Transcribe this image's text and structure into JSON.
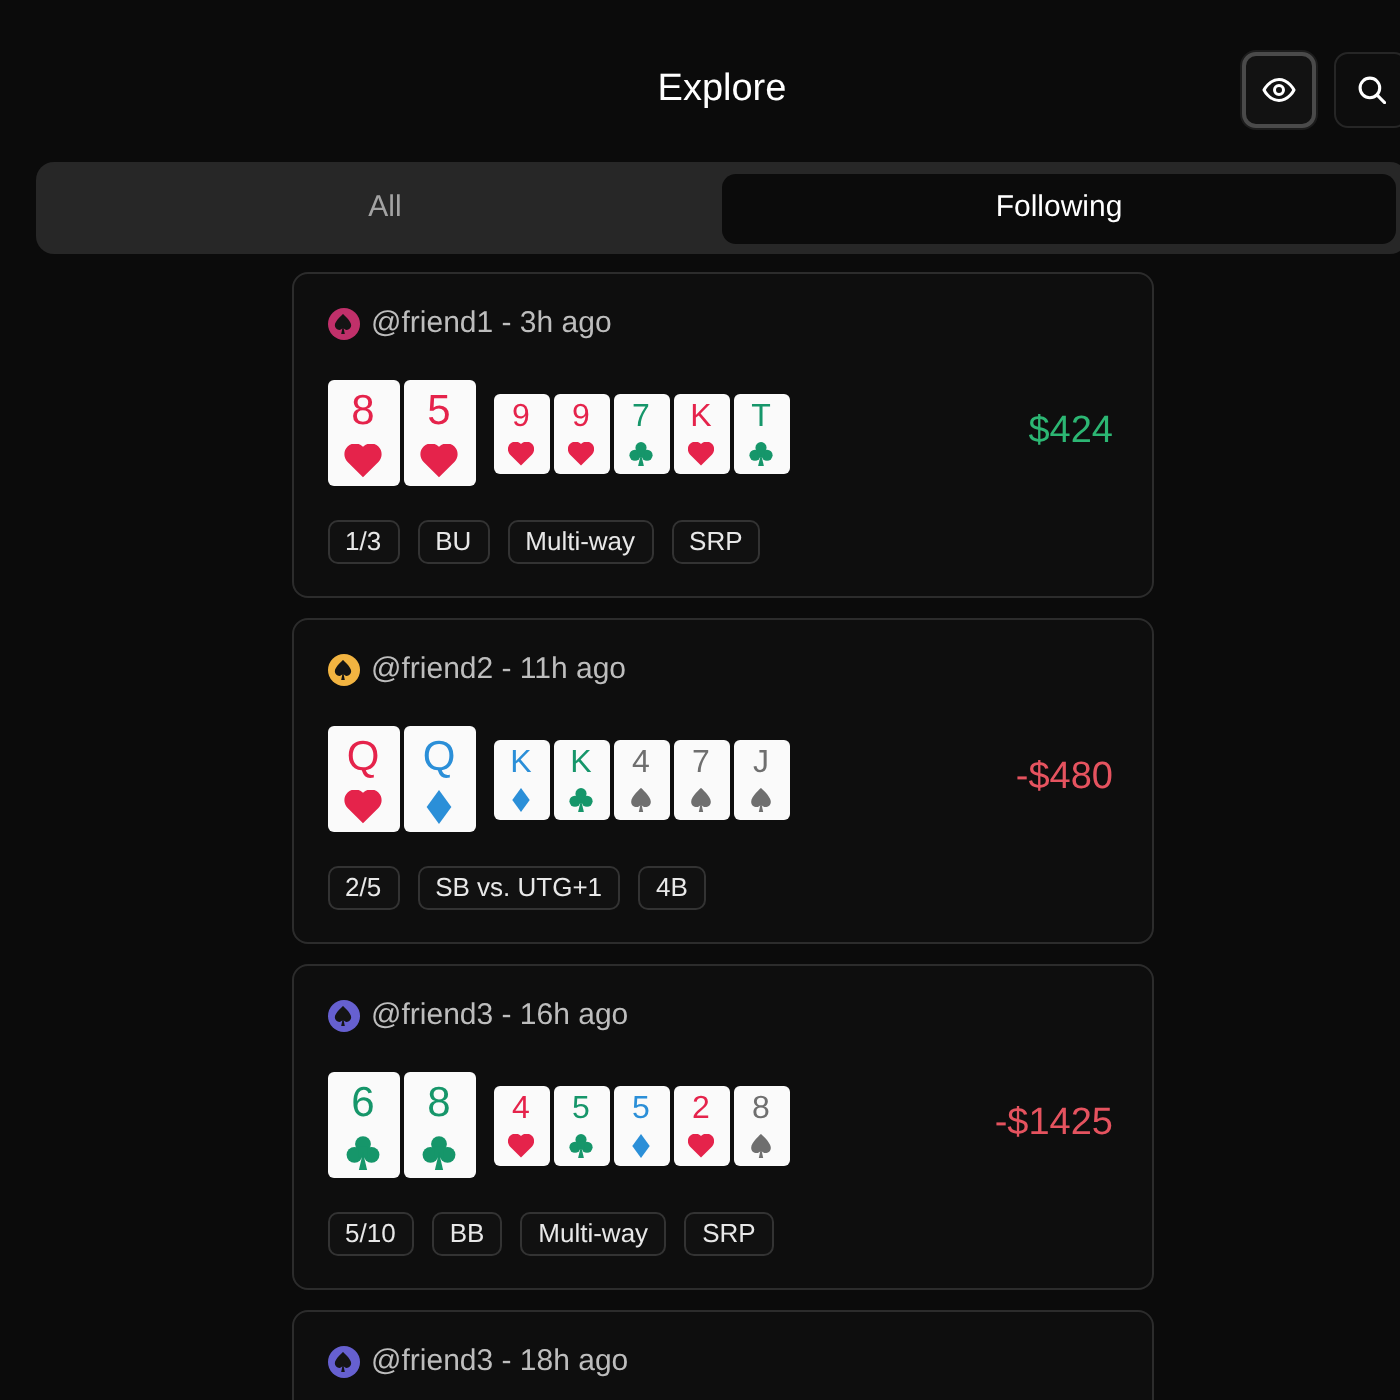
{
  "header": {
    "title": "Explore",
    "buttons": [
      {
        "kind": "eye",
        "selected": true
      },
      {
        "kind": "search",
        "selected": false
      }
    ]
  },
  "tabs": [
    {
      "label": "All",
      "selected": false
    },
    {
      "label": "Following",
      "selected": true
    }
  ],
  "posts": [
    {
      "color": "#c0306a",
      "byline": "@friend1 - 3h ago",
      "hole_cards": [
        {
          "rank": "8",
          "kind": "hearts"
        },
        {
          "rank": "5",
          "kind": "hearts"
        }
      ],
      "board": [
        {
          "rank": "9",
          "kind": "hearts"
        },
        {
          "rank": "9",
          "kind": "hearts"
        },
        {
          "rank": "7",
          "kind": "clubs"
        },
        {
          "rank": "K",
          "kind": "hearts"
        },
        {
          "rank": "T",
          "kind": "clubs"
        }
      ],
      "result": {
        "text": "$424",
        "kind": "win"
      },
      "tags": [
        "1/3",
        "BU",
        "Multi-way",
        "SRP"
      ]
    },
    {
      "color": "#f2b441",
      "byline": "@friend2 - 11h ago",
      "hole_cards": [
        {
          "rank": "Q",
          "kind": "hearts"
        },
        {
          "rank": "Q",
          "kind": "diamonds"
        }
      ],
      "board": [
        {
          "rank": "K",
          "kind": "diamonds"
        },
        {
          "rank": "K",
          "kind": "clubs"
        },
        {
          "rank": "4",
          "kind": "spades"
        },
        {
          "rank": "7",
          "kind": "spades"
        },
        {
          "rank": "J",
          "kind": "spades"
        }
      ],
      "result": {
        "text": "-$480",
        "kind": "loss"
      },
      "tags": [
        "2/5",
        "SB vs. UTG+1",
        "4B"
      ]
    },
    {
      "color": "#6660d0",
      "byline": "@friend3 - 16h ago",
      "hole_cards": [
        {
          "rank": "6",
          "kind": "clubs"
        },
        {
          "rank": "8",
          "kind": "clubs"
        }
      ],
      "board": [
        {
          "rank": "4",
          "kind": "hearts"
        },
        {
          "rank": "5",
          "kind": "clubs"
        },
        {
          "rank": "5",
          "kind": "diamonds"
        },
        {
          "rank": "2",
          "kind": "hearts"
        },
        {
          "rank": "8",
          "kind": "spades"
        }
      ],
      "result": {
        "text": "-$1425",
        "kind": "loss"
      },
      "tags": [
        "5/10",
        "BB",
        "Multi-way",
        "SRP"
      ]
    },
    {
      "color": "#6660d0",
      "byline": "@friend3 - 18h ago"
    }
  ]
}
